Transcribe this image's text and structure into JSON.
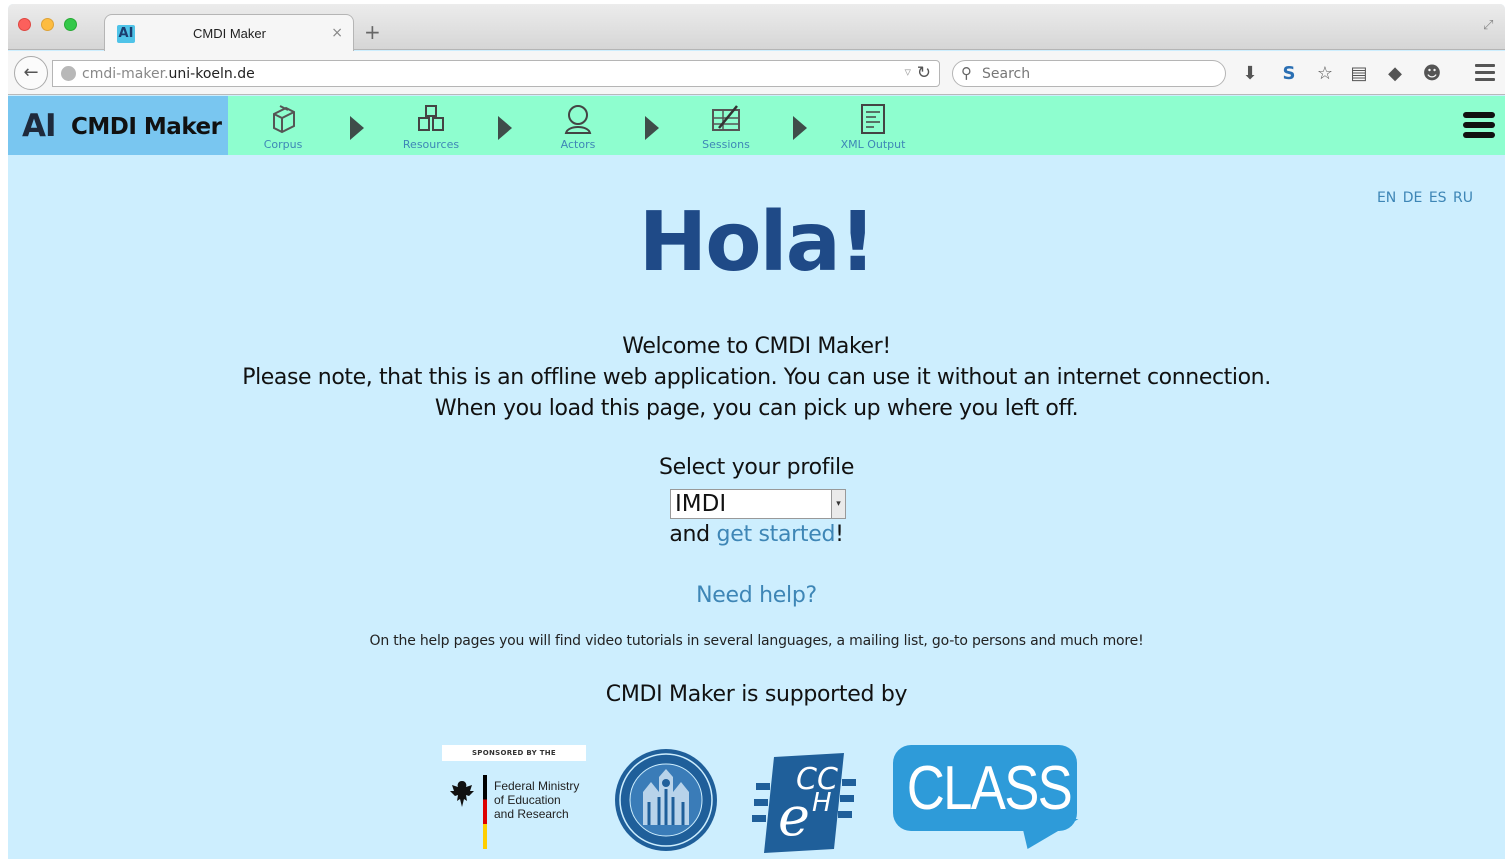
{
  "browser": {
    "tab_favicon_text": "AI",
    "tab_title": "CMDI Maker",
    "tab_close": "×",
    "new_tab": "+",
    "url_plain": "cmdi-maker.",
    "url_domain": "uni-koeln.de",
    "search_placeholder": "Search"
  },
  "app": {
    "logo_text": "AI",
    "name": "CMDI Maker",
    "steps": [
      {
        "label": "Corpus",
        "icon": "corpus-box-icon"
      },
      {
        "label": "Resources",
        "icon": "resources-blocks-icon"
      },
      {
        "label": "Actors",
        "icon": "actor-person-icon"
      },
      {
        "label": "Sessions",
        "icon": "sessions-edit-icon"
      },
      {
        "label": "XML Output",
        "icon": "xml-document-icon"
      }
    ]
  },
  "languages": [
    "EN",
    "DE",
    "ES",
    "RU"
  ],
  "main": {
    "greeting": "Hola!",
    "welcome_lines": [
      "Welcome to CMDI Maker!",
      "Please note, that this is an offline web application. You can use it without an internet connection.",
      "When you load this page, you can pick up where you left off."
    ],
    "select_profile_label": "Select your profile",
    "profile_value": "IMDI",
    "and_text": "and ",
    "get_started_link": "get started",
    "exclamation": "!",
    "need_help_link": "Need help?",
    "help_description": "On the help pages you will find video tutorials in several languages, a mailing list, go-to persons and much more!",
    "supported_by": "CMDI Maker is supported by"
  },
  "sponsors": {
    "bmbf_top": "SPONSORED BY THE",
    "bmbf_lines": [
      "Federal Ministry",
      "of Education",
      "and Research"
    ],
    "class_text": "CLASS",
    "ceh_text": "CCeH"
  },
  "colors": {
    "header_green": "#8efecf",
    "brand_blue": "#79c6f0",
    "content_bg": "#cdeefe",
    "heading_blue": "#1f4a87",
    "link_blue": "#3e86b6"
  }
}
